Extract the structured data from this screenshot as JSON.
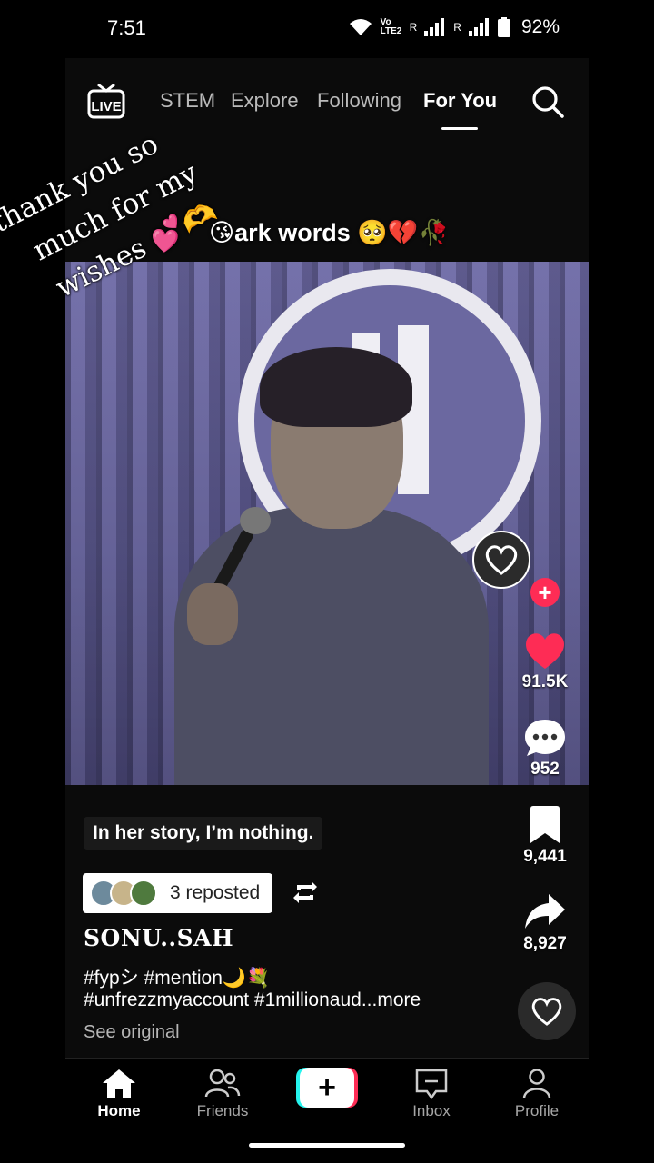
{
  "status_bar": {
    "time": "7:51",
    "volte_label": "Vo LTE2",
    "roaming_1": "R",
    "roaming_2": "R",
    "battery": "92%"
  },
  "top_nav": {
    "live_label": "LIVE",
    "tabs": [
      {
        "label": "STEM",
        "active": false
      },
      {
        "label": "Explore",
        "active": false
      },
      {
        "label": "Following",
        "active": false
      },
      {
        "label": "For You",
        "active": true
      }
    ],
    "search_icon": "search-icon"
  },
  "video": {
    "overlay_text": "ark words 🥺💔🥀",
    "overlay_emoji_prefix": "😘",
    "handwriting_lines": [
      "thank you so",
      "much for my",
      "wishes 💕🫶"
    ],
    "subtitle": "In her story, I’m nothing."
  },
  "right_rail": {
    "likes": "91.5K",
    "comments": "952",
    "bookmarks": "9,441",
    "shares": "8,927",
    "like_color": "#fe2c55",
    "follow_plus": "+"
  },
  "post": {
    "repost_text": "3 reposted",
    "username": "SONU..SAH",
    "tags_line1": "#fypシ #mention🌙💐",
    "tags_line2": "#unfrezzmyaccount #1millionaud...more",
    "see_original": "See original"
  },
  "bottom_nav": {
    "items": [
      {
        "label": "Home",
        "icon": "home-icon",
        "active": true
      },
      {
        "label": "Friends",
        "icon": "friends-icon",
        "active": false
      },
      {
        "label": "",
        "icon": "create-plus-icon",
        "active": false
      },
      {
        "label": "Inbox",
        "icon": "inbox-icon",
        "active": false
      },
      {
        "label": "Profile",
        "icon": "profile-icon",
        "active": false
      }
    ],
    "create_symbol": "+"
  }
}
